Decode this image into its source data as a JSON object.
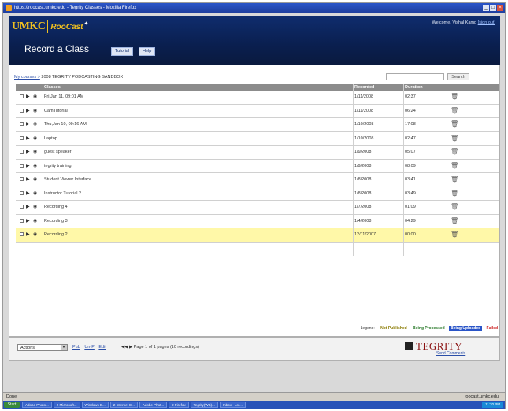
{
  "browser": {
    "title": "https://roocast.umkc.edu - Tegrity Classes - Mozilla Firefox",
    "status_left": "Done",
    "status_right": "roocast.umkc.edu"
  },
  "header": {
    "logo_umkc": "UMKC",
    "logo_roocast": "RooCast",
    "welcome_text": "Welcome, Vishal Kamp",
    "sign_out": "[sign out]",
    "page_title": "Record a Class",
    "nav": [
      "Tutorial",
      "Help"
    ]
  },
  "breadcrumb": {
    "link": "My courses >",
    "current": "2008 TEGRITY PODCASTING SANDBOX"
  },
  "search": {
    "placeholder": "",
    "button": "Search"
  },
  "table": {
    "headers": {
      "classes": "Classes",
      "recorded": "Recorded",
      "duration": "Duration"
    },
    "rows": [
      {
        "name": "Fri,Jan 11, 09:01 AM",
        "recorded": "1/11/2008",
        "duration": "02:37"
      },
      {
        "name": "CamTutorial",
        "recorded": "1/11/2008",
        "duration": "06:24"
      },
      {
        "name": "Thu,Jan 10, 09:16 AM",
        "recorded": "1/10/2008",
        "duration": "17:08"
      },
      {
        "name": "Laptop",
        "recorded": "1/10/2008",
        "duration": "02:47"
      },
      {
        "name": "guest speaker",
        "recorded": "1/9/2008",
        "duration": "05:07"
      },
      {
        "name": "tegrity training",
        "recorded": "1/9/2008",
        "duration": "08:09"
      },
      {
        "name": "Student Viewer Interface",
        "recorded": "1/8/2008",
        "duration": "03:41"
      },
      {
        "name": "Instructor Tutorial 2",
        "recorded": "1/8/2008",
        "duration": "03:49"
      },
      {
        "name": "Recording 4",
        "recorded": "1/7/2008",
        "duration": "01:09"
      },
      {
        "name": "Recording 3",
        "recorded": "1/4/2008",
        "duration": "04:29"
      },
      {
        "name": "Recording 2",
        "recorded": "12/11/2007",
        "duration": "00:00"
      }
    ],
    "selected_index": 10
  },
  "legend": {
    "label": "Legend:",
    "items": [
      {
        "text": "Not Published",
        "color": "#e8d800"
      },
      {
        "text": "Being Processed",
        "color": "#3aa83a"
      },
      {
        "text": "Being Uploaded",
        "color": "#2a55c8"
      },
      {
        "text": "Failed",
        "color": "#cc2222"
      }
    ]
  },
  "footer": {
    "actions_select": "Actions",
    "links": [
      "Pub",
      "Un-P",
      "Edit"
    ],
    "pager_text": "Page 1 of 1 pages (10 recordings)",
    "tegrity_logo": "TEGRITY",
    "tegrity_sub": "Send Comments"
  },
  "taskbar": {
    "start": "Start",
    "tasks": [
      "Adobe Photo...",
      "2 Microsoft...",
      "Windows E...",
      "2 Internet E...",
      "Adobe Phot...",
      "2 Firefox",
      "Tegrity(WS)...",
      "Inbox - Lot..."
    ],
    "clock": "11:20 PM"
  },
  "colors": {
    "header_blue": "#0f2d6e",
    "selected_row": "#fff8a8",
    "accent_gold": "#f0c020"
  }
}
